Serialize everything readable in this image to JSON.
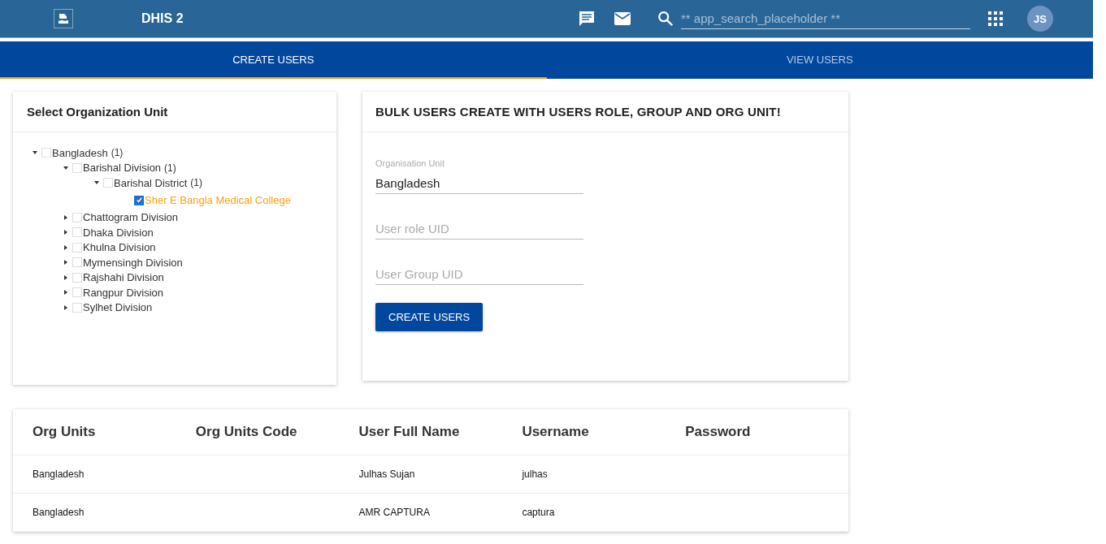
{
  "header": {
    "title": "DHIS 2",
    "search": {
      "placeholder": "** app_search_placeholder **"
    },
    "avatar": "JS"
  },
  "tabs": [
    {
      "label": "CREATE USERS",
      "selected": true
    },
    {
      "label": "VIEW USERS",
      "selected": false
    }
  ],
  "org_panel": {
    "title": "Select Organization Unit",
    "tree": [
      {
        "name": "Bangladesh",
        "count": "(1)",
        "expanded": true,
        "checked": false,
        "children": [
          {
            "name": "Barishal Division",
            "count": "(1)",
            "expanded": true,
            "checked": false,
            "children": [
              {
                "name": "Barishal District",
                "count": "(1)",
                "expanded": true,
                "checked": false,
                "children": [
                  {
                    "name": "Sher E Bangla Medical College",
                    "checked": true
                  }
                ]
              }
            ]
          },
          {
            "name": "Chattogram Division",
            "expanded": false,
            "checked": false
          },
          {
            "name": "Dhaka Division",
            "expanded": false,
            "checked": false
          },
          {
            "name": "Khulna Division",
            "expanded": false,
            "checked": false
          },
          {
            "name": "Mymensingh Division",
            "expanded": false,
            "checked": false
          },
          {
            "name": "Rajshahi Division",
            "expanded": false,
            "checked": false
          },
          {
            "name": "Rangpur Division",
            "expanded": false,
            "checked": false
          },
          {
            "name": "Sylhet Division",
            "expanded": false,
            "checked": false
          }
        ]
      }
    ]
  },
  "form": {
    "title": "BULK USERS CREATE WITH USERS ROLE, GROUP AND ORG UNIT!",
    "fields": [
      {
        "label": "Organisation Unit",
        "value": "Bangladesh"
      },
      {
        "placeholder": "User role UID"
      },
      {
        "placeholder": "User Group UID"
      }
    ],
    "button": "CREATE USERS"
  },
  "table": {
    "columns": [
      "Org Units",
      "Org Units Code",
      "User Full Name",
      "Username",
      "Password"
    ],
    "rows": [
      {
        "org_unit": "Bangladesh",
        "full_name": "Julhas Sujan",
        "username": "julhas"
      },
      {
        "org_unit": "Bangladesh",
        "full_name": "AMR CAPTURA",
        "username": "captura"
      }
    ]
  }
}
